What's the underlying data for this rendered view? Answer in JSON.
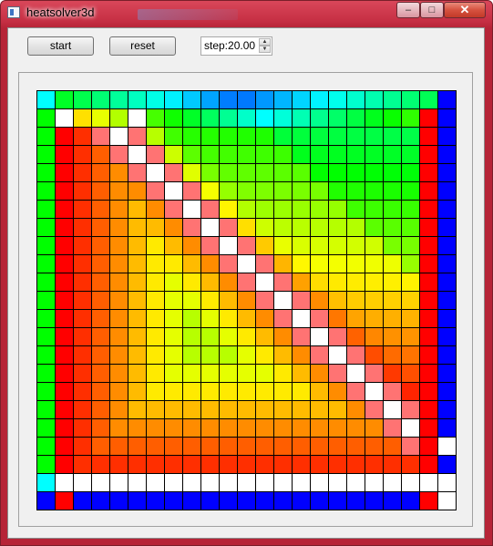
{
  "window": {
    "title": "heatsolver3d"
  },
  "titlebar_controls": {
    "minimize": "–",
    "maximize": "□",
    "close": "✕"
  },
  "toolbar": {
    "start_label": "start",
    "reset_label": "reset",
    "step_value": "step:20.00"
  },
  "icons": {
    "app": "app-window-icon",
    "spin_up": "chevron-up-icon",
    "spin_down": "chevron-down-icon"
  },
  "heatmap": {
    "rows": 23,
    "cols": 23,
    "colors": {
      "boundary_left": "#00ff00",
      "boundary_right": "#0000ff",
      "boundary_bottom_row": "#0000ff",
      "hot": "#ff0000",
      "cold_edge": "#00ffff",
      "white": "#ffffff"
    }
  }
}
